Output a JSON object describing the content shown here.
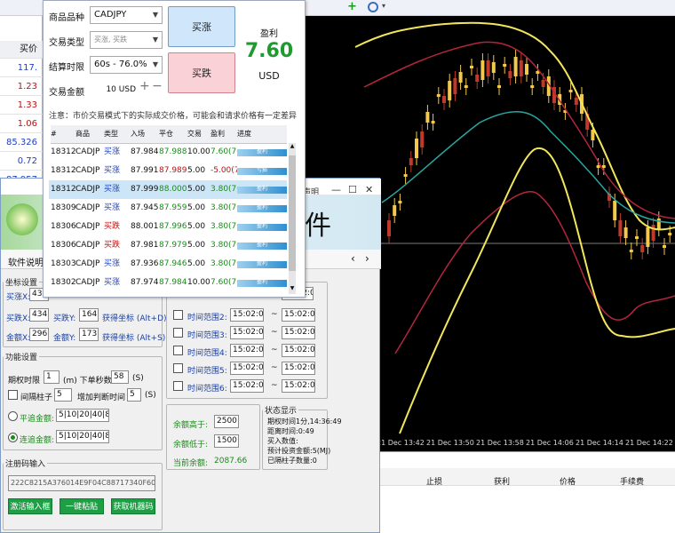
{
  "toolbar": {
    "icons": [
      "plus-icon",
      "target-icon",
      "dropdown-icon"
    ]
  },
  "quotes": {
    "header": "买价",
    "rows": [
      {
        "value": "117.",
        "dir": "up"
      },
      {
        "value": "1.23",
        "dir": "down"
      },
      {
        "value": "1.33",
        "dir": "down"
      },
      {
        "value": "1.06",
        "dir": "down"
      },
      {
        "value": "85.326",
        "dir": "up"
      },
      {
        "value": "0.72",
        "dir": "up"
      },
      {
        "value": "87.957",
        "dir": "up"
      },
      {
        "value": "1.06",
        "dir": "up"
      }
    ]
  },
  "panel": {
    "symbol_label": "商品品种",
    "symbol_value": "CADJPY",
    "type_label": "交易类型",
    "type_value": "买涨, 买跌",
    "expiry_label": "结算时限",
    "expiry_value": "60s - 76.0%",
    "amount_label": "交易金额",
    "amount_value": "10 USD",
    "buy_up": "买涨",
    "buy_down": "买跌",
    "profit_label": "盈利",
    "profit_value": "7.60",
    "profit_currency": "USD",
    "notice": "注意：市价交易模式下的实际成交价格，可能会和请求价格有一定差异",
    "table_headers": [
      "#",
      "商品",
      "类型",
      "入场",
      "平仓",
      "交易",
      "盈利",
      "进度"
    ],
    "rows": [
      {
        "id": "18312",
        "sym": "CADJP",
        "type": "买涨",
        "entry": "87.984",
        "close": "87.9880",
        "amt": "10.00",
        "profit": "7.60(76",
        "status": "盈利",
        "closeColor": "#1a8a1a",
        "profitColor": "#1a8a1a"
      },
      {
        "id": "18312",
        "sym": "CADJP",
        "type": "买涨",
        "entry": "87.991",
        "close": "87.9890",
        "amt": "5.00",
        "profit": "-5.00(7",
        "status": "亏损",
        "closeColor": "#c01010",
        "profitColor": "#c01010"
      },
      {
        "id": "18312",
        "sym": "CADJP",
        "type": "买涨",
        "entry": "87.999",
        "close": "88.0000",
        "amt": "5.00",
        "profit": "3.80(76",
        "status": "盈利",
        "closeColor": "#1a8a1a",
        "profitColor": "#1a8a1a"
      },
      {
        "id": "18309",
        "sym": "CADJP",
        "type": "买涨",
        "entry": "87.945",
        "close": "87.9590",
        "amt": "5.00",
        "profit": "3.80(76",
        "status": "盈利",
        "closeColor": "#1a8a1a",
        "profitColor": "#1a8a1a"
      },
      {
        "id": "18306",
        "sym": "CADJP",
        "type": "买跌",
        "entry": "88.001",
        "close": "87.9960",
        "amt": "5.00",
        "profit": "3.80(76",
        "status": "盈利",
        "closeColor": "#1a8a1a",
        "profitColor": "#1a8a1a"
      },
      {
        "id": "18306",
        "sym": "CADJP",
        "type": "买跌",
        "entry": "87.981",
        "close": "87.9790",
        "amt": "5.00",
        "profit": "3.80(76",
        "status": "盈利",
        "closeColor": "#1a8a1a",
        "profitColor": "#1a8a1a"
      },
      {
        "id": "18303",
        "sym": "CADJP",
        "type": "买涨",
        "entry": "87.936",
        "close": "87.9460",
        "amt": "5.00",
        "profit": "3.80(76",
        "status": "盈利",
        "closeColor": "#1a8a1a",
        "profitColor": "#1a8a1a"
      },
      {
        "id": "18302",
        "sym": "CADJP",
        "type": "买涨",
        "entry": "87.974",
        "close": "87.9840",
        "amt": "10.00",
        "profit": "7.60(76",
        "status": "盈利",
        "closeColor": "#1a8a1a",
        "profitColor": "#1a8a1a"
      }
    ]
  },
  "assistant": {
    "title_fragment": "声明",
    "logo_fragment": "件",
    "tab_label": "软件说明",
    "coord_legend": "坐标设置",
    "up_x_label": "买涨X:",
    "up_x": "430",
    "down_x_label": "买跌X:",
    "down_x": "434",
    "down_y_label": "买跌Y:",
    "down_y": "164",
    "get_coord": "获得坐标 (Alt+D)",
    "amt_x_label": "金额X:",
    "amt_x": "296",
    "amt_y_label": "金额Y:",
    "amt_y": "173",
    "get_coord2": "获得坐标 (Alt+S)",
    "func_legend": "功能设置",
    "expiry_label": "期权时限",
    "expiry_val": "1",
    "expiry_unit": "(m) 下单秒数",
    "seconds_val": "58",
    "seconds_unit": "(S)",
    "interval_label": "间隔柱子",
    "interval_val": "5",
    "add_time_label": "增加判断时间",
    "add_time_val": "5",
    "add_time_unit": "(S)",
    "flat_label": "平追金额:",
    "flat_val": "5|10|20|40|80",
    "chase_label": "连追金额:",
    "chase_val": "5|10|20|40|80",
    "reg_legend": "注册码输入",
    "reg_code": "222C8215A376014E9F04C88717340F6094518",
    "btn_enter": "激活输入框",
    "btn_paste": "一键粘贴",
    "btn_machine": "获取机器码",
    "time_ranges": [
      {
        "label": "时间范围2:",
        "from": "15:02:03",
        "to": "15:02:03"
      },
      {
        "label": "时间范围3:",
        "from": "15:02:03",
        "to": "15:02:03"
      },
      {
        "label": "时间范围4:",
        "from": "15:02:03",
        "to": "15:02:03"
      },
      {
        "label": "时间范围5:",
        "from": "15:02:03",
        "to": "15:02:03"
      },
      {
        "label": "时间范围6:",
        "from": "15:02:03",
        "to": "15:02:03"
      }
    ],
    "time_top_to": "15:02:03",
    "tilde": "~",
    "bal_high_label": "余额高于:",
    "bal_high": "2500",
    "bal_low_label": "余额低于:",
    "bal_low": "1500",
    "bal_cur_label": "当前余额:",
    "bal_cur": "2087.66",
    "status_legend": "状态显示",
    "status_lines": [
      "期权时间1分,14:36:49",
      "距离时间:0:49",
      "买入数值:",
      "预计投资金额:5(MJ)",
      "已隔柱子数量:0"
    ]
  },
  "chart": {
    "time_labels": [
      "21 Dec 13:42",
      "21 Dec 13:50",
      "21 Dec 13:58",
      "21 Dec 14:06",
      "21 Dec 14:14",
      "21 Dec 14:22",
      "21 Dec 14:30"
    ]
  },
  "terminal": {
    "columns": [
      "止损",
      "获利",
      "价格",
      "手续费"
    ]
  }
}
